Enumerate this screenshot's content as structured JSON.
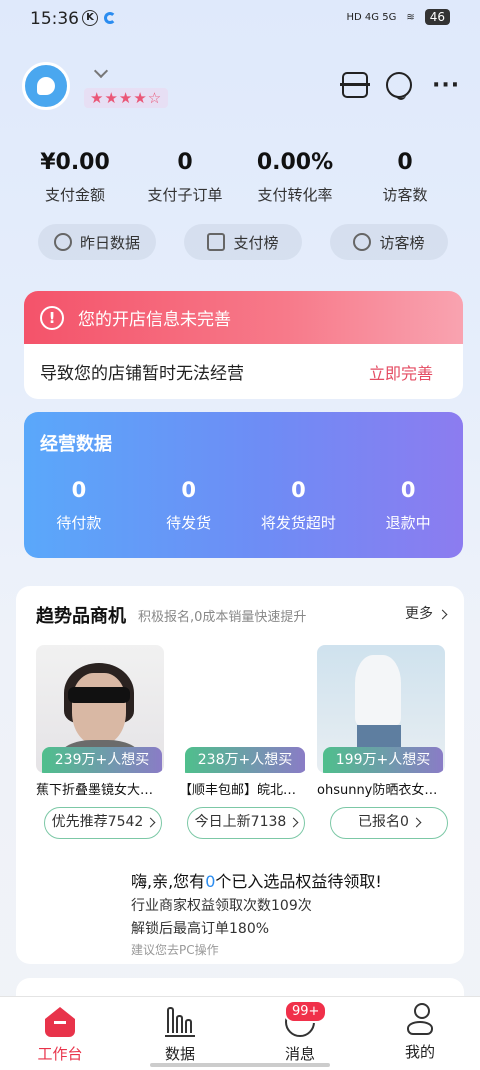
{
  "status_bar": {
    "time": "15:36",
    "k_icon": "K",
    "network": "HD 4G 5G",
    "battery": "46"
  },
  "header": {
    "stars": "★★★★☆"
  },
  "stats": [
    {
      "value": "¥0.00",
      "label": "支付金额"
    },
    {
      "value": "0",
      "label": "支付子订单"
    },
    {
      "value": "0.00%",
      "label": "支付转化率"
    },
    {
      "value": "0",
      "label": "访客数"
    }
  ],
  "pills": [
    {
      "label": "昨日数据",
      "icon": "compass-icon"
    },
    {
      "label": "支付榜",
      "icon": "bag-icon"
    },
    {
      "label": "访客榜",
      "icon": "user-icon"
    }
  ],
  "alert": {
    "title": "您的开店信息未完善",
    "message": "导致您的店铺暂时无法经营",
    "action": "立即完善"
  },
  "ops": {
    "title": "经营数据",
    "items": [
      {
        "value": "0",
        "label": "待付款"
      },
      {
        "value": "0",
        "label": "待发货"
      },
      {
        "value": "0",
        "label": "将发货超时"
      },
      {
        "value": "0",
        "label": "退款中"
      }
    ]
  },
  "trend": {
    "title": "趋势品商机",
    "subtitle": "积极报名,0成本销量快速提升",
    "more": "更多",
    "products": [
      {
        "want": "239万+人想买",
        "name": "蕉下折叠墨镜女大…",
        "button": "优先推荐7542"
      },
      {
        "want": "238万+人想买",
        "name": "【顺丰包邮】皖北…",
        "button": "今日上新7138"
      },
      {
        "want": "199万+人想买",
        "name": "ohsunny防晒衣女…",
        "button": "已报名0"
      }
    ],
    "promo": {
      "prefix": "嗨,亲,您有",
      "count": "0",
      "suffix": "个已入选品权益待领取!",
      "line1": "行业商家权益领取次数109次",
      "line2": "解锁后最高订单180%",
      "hint": "建议您去PC操作"
    }
  },
  "tabbar": {
    "tabs": [
      "工作台",
      "数据",
      "消息",
      "我的"
    ],
    "badge": "99+",
    "active_color": "#e8334a"
  }
}
